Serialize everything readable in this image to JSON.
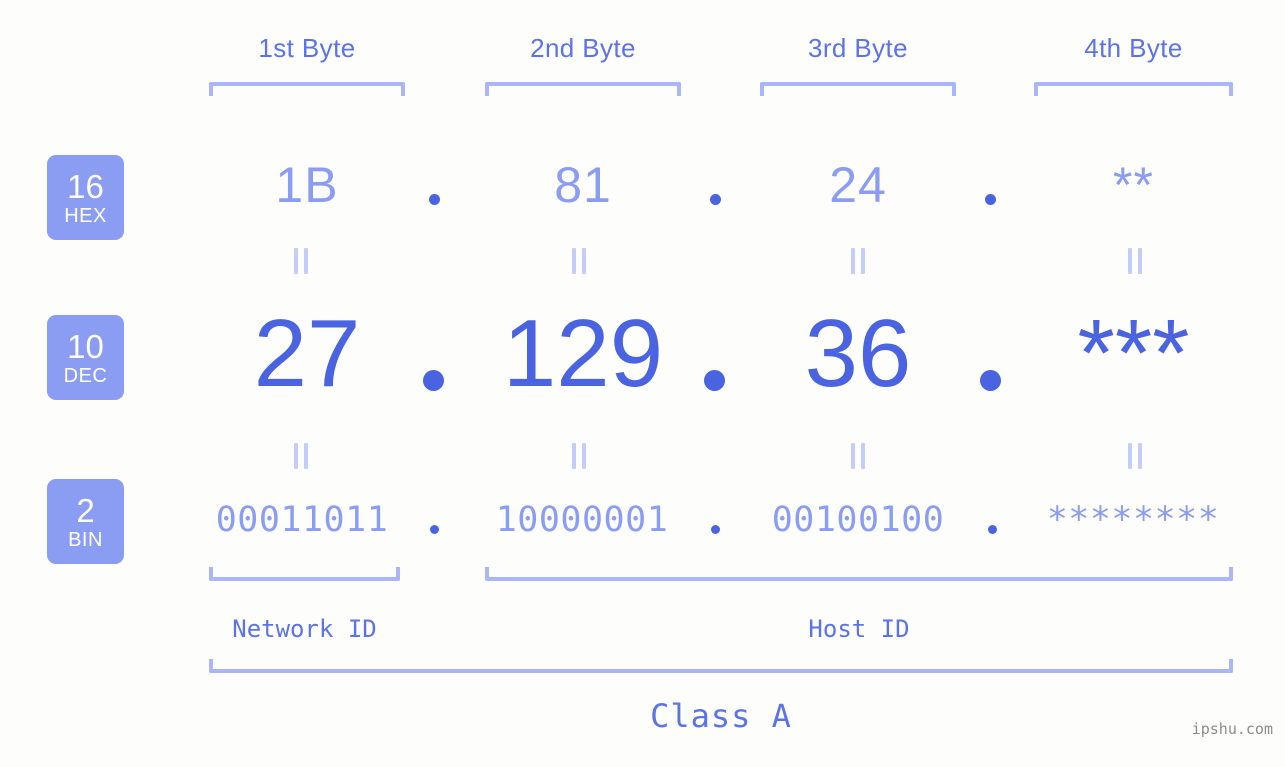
{
  "page": {
    "background_color": "#fdfefb",
    "accent_strong": "#4a63e0",
    "accent_light": "#8b9cf3",
    "accent_pale": "#aab6fb",
    "watermark": "ipshu.com"
  },
  "byte_headers": [
    {
      "label": "1st Byte"
    },
    {
      "label": "2nd Byte"
    },
    {
      "label": "3rd Byte"
    },
    {
      "label": "4th Byte"
    }
  ],
  "radix_badges": [
    {
      "number": "16",
      "name": "HEX"
    },
    {
      "number": "10",
      "name": "DEC"
    },
    {
      "number": "2",
      "name": "BIN"
    }
  ],
  "rows": {
    "hex": {
      "values": [
        "1B",
        "81",
        "24",
        "**"
      ]
    },
    "dec": {
      "values": [
        "27",
        "129",
        "36",
        "***"
      ]
    },
    "bin": {
      "values": [
        "00011011",
        "10000001",
        "00100100",
        "********"
      ]
    }
  },
  "separator": ".",
  "equals_mark": "=",
  "id_sections": [
    {
      "label": "Network ID"
    },
    {
      "label": "Host ID"
    }
  ],
  "class_section": {
    "label": "Class A"
  }
}
